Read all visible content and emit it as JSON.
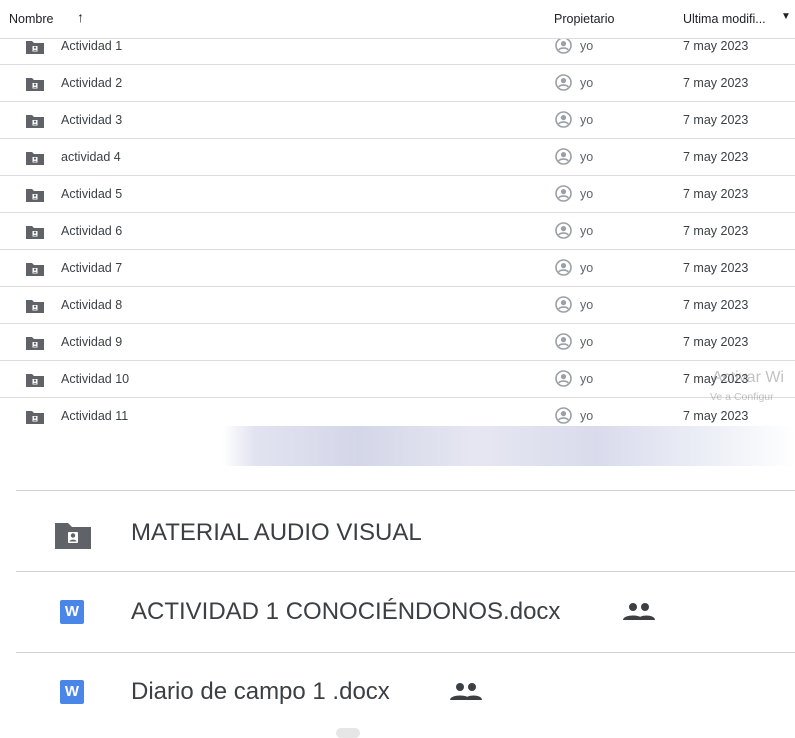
{
  "header": {
    "name_label": "Nombre",
    "sort_icon": "arrow-up-icon",
    "owner_label": "Propietario",
    "modified_label": "Ultima modifi...",
    "modified_caret": "▼"
  },
  "rows": [
    {
      "name": "Actividad 1",
      "owner": "yo",
      "date": "7 may 2023"
    },
    {
      "name": "Actividad 2",
      "owner": "yo",
      "date": "7 may 2023"
    },
    {
      "name": "Actividad 3",
      "owner": "yo",
      "date": "7 may 2023"
    },
    {
      "name": "actividad 4",
      "owner": "yo",
      "date": "7 may 2023"
    },
    {
      "name": "Actividad 5",
      "owner": "yo",
      "date": "7 may 2023"
    },
    {
      "name": "Actividad 6",
      "owner": "yo",
      "date": "7 may 2023"
    },
    {
      "name": "Actividad 7",
      "owner": "yo",
      "date": "7 may 2023"
    },
    {
      "name": "Actividad 8",
      "owner": "yo",
      "date": "7 may 2023"
    },
    {
      "name": "Actividad 9",
      "owner": "yo",
      "date": "7 may 2023"
    },
    {
      "name": "Actividad 10",
      "owner": "yo",
      "date": "7 may 2023"
    },
    {
      "name": "Actividad 11",
      "owner": "yo",
      "date": "7 may 2023"
    }
  ],
  "watermark": {
    "line1": "Activar Wi",
    "line2": "Ve a Configur"
  },
  "bottom_items": [
    {
      "name": "MATERIAL AUDIO VISUAL",
      "type": "shared-folder"
    },
    {
      "name": "ACTIVIDAD 1 CONOCIÉNDONOS.docx",
      "type": "word-doc",
      "icon_label": "W",
      "shared": true
    },
    {
      "name": "Diario de campo 1 .docx",
      "type": "word-doc",
      "icon_label": "W",
      "shared": true
    }
  ],
  "colors": {
    "word": "#4a86e8",
    "folder": "#5f6368",
    "divider": "#dadce0"
  }
}
